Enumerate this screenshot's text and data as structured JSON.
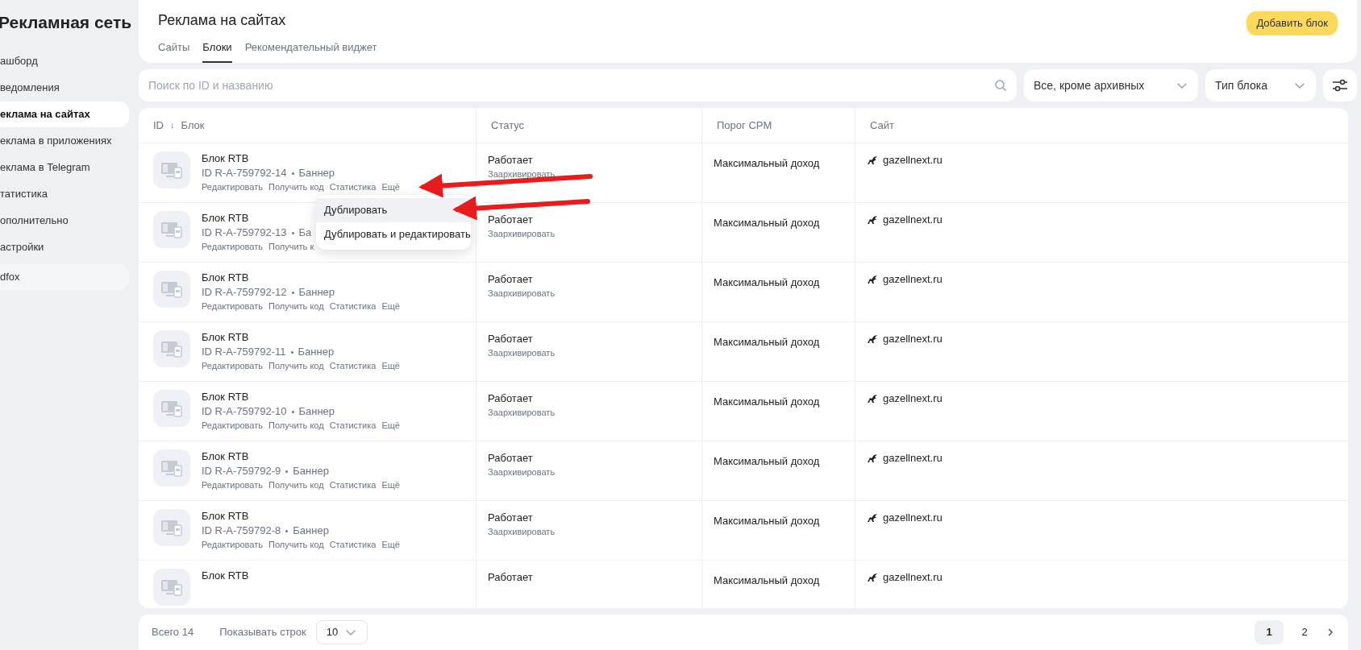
{
  "sidebar": {
    "title": "Рекламная сеть",
    "items": [
      {
        "label": "ашборд",
        "selected": false,
        "kind": "nav"
      },
      {
        "label": "ведомления",
        "selected": false,
        "kind": "nav"
      },
      {
        "label": "еклама на сайтах",
        "selected": true,
        "kind": "nav"
      },
      {
        "label": "еклама в приложениях",
        "selected": false,
        "kind": "nav"
      },
      {
        "label": "еклама в Telegram",
        "selected": false,
        "kind": "nav"
      },
      {
        "label": "татистика",
        "selected": false,
        "kind": "nav"
      },
      {
        "label": "ополнительно",
        "selected": false,
        "kind": "nav"
      },
      {
        "label": "астройки",
        "selected": false,
        "kind": "nav"
      },
      {
        "label": "dfox",
        "selected": false,
        "kind": "promo"
      }
    ]
  },
  "header": {
    "title": "Реклама на сайтах",
    "add_button": "Добавить блок",
    "tabs": [
      {
        "label": "Сайты",
        "selected": false
      },
      {
        "label": "Блоки",
        "selected": true
      },
      {
        "label": "Рекомендательный виджет",
        "selected": false
      }
    ]
  },
  "filters": {
    "search": {
      "placeholder": "Поиск по ID и названию"
    },
    "status_select": "Все, кроме архивных",
    "type_select": "Тип блока"
  },
  "table": {
    "columns": [
      {
        "sort": "ID",
        "sort_arrow": "↓",
        "label": "Блок"
      },
      {
        "label": "Статус"
      },
      {
        "label": "Порог CPM"
      },
      {
        "label": "Сайт"
      }
    ],
    "rows": [
      {
        "name": "Блок RTB",
        "id": "ID R-A-759792-14",
        "type": "Баннер",
        "actions": [
          "Редактировать",
          "Получить код",
          "Статистика",
          "Ещё"
        ],
        "status": "Работает",
        "archive": "Заархивировать",
        "cpm": "Максимальный доход",
        "site": "gazellnext.ru",
        "menu": [
          {
            "label": "Дублировать",
            "selected": true
          },
          {
            "label": "Дублировать и редактировать",
            "selected": false
          }
        ]
      },
      {
        "name": "Блок RTB",
        "id": "ID R-A-759792-13",
        "type": "Ба",
        "actions": [
          "Редактировать",
          "Получить к"
        ],
        "status": "Работает",
        "archive": "Заархивировать",
        "cpm": "Максимальный доход",
        "site": "gazellnext.ru"
      },
      {
        "name": "Блок RTB",
        "id": "ID R-A-759792-12",
        "type": "Баннер",
        "actions": [
          "Редактировать",
          "Получить код",
          "Статистика",
          "Ещё"
        ],
        "status": "Работает",
        "archive": "Заархивировать",
        "cpm": "Максимальный доход",
        "site": "gazellnext.ru"
      },
      {
        "name": "Блок RTB",
        "id": "ID R-A-759792-11",
        "type": "Баннер",
        "actions": [
          "Редактировать",
          "Получить код",
          "Статистика",
          "Ещё"
        ],
        "status": "Работает",
        "archive": "Заархивировать",
        "cpm": "Максимальный доход",
        "site": "gazellnext.ru"
      },
      {
        "name": "Блок RTB",
        "id": "ID R-A-759792-10",
        "type": "Баннер",
        "actions": [
          "Редактировать",
          "Получить код",
          "Статистика",
          "Ещё"
        ],
        "status": "Работает",
        "archive": "Заархивировать",
        "cpm": "Максимальный доход",
        "site": "gazellnext.ru"
      },
      {
        "name": "Блок RTB",
        "id": "ID R-A-759792-9",
        "type": "Баннер",
        "actions": [
          "Редактировать",
          "Получить код",
          "Статистика",
          "Ещё"
        ],
        "status": "Работает",
        "archive": "Заархивировать",
        "cpm": "Максимальный доход",
        "site": "gazellnext.ru"
      },
      {
        "name": "Блок RTB",
        "id": "ID R-A-759792-8",
        "type": "Баннер",
        "actions": [
          "Редактировать",
          "Получить код",
          "Статистика",
          "Ещё"
        ],
        "status": "Работает",
        "archive": "Заархивировать",
        "cpm": "Максимальный доход",
        "site": "gazellnext.ru"
      },
      {
        "name": "Блок RTB",
        "status": "Работает",
        "cpm": "Максимальный доход",
        "site": "gazellnext.ru"
      }
    ]
  },
  "footer": {
    "total": "Всего 14",
    "rows_label": "Показывать строк",
    "rows_value": "10",
    "pages": [
      {
        "label": "1",
        "selected": true
      },
      {
        "label": "2",
        "selected": false
      }
    ]
  }
}
